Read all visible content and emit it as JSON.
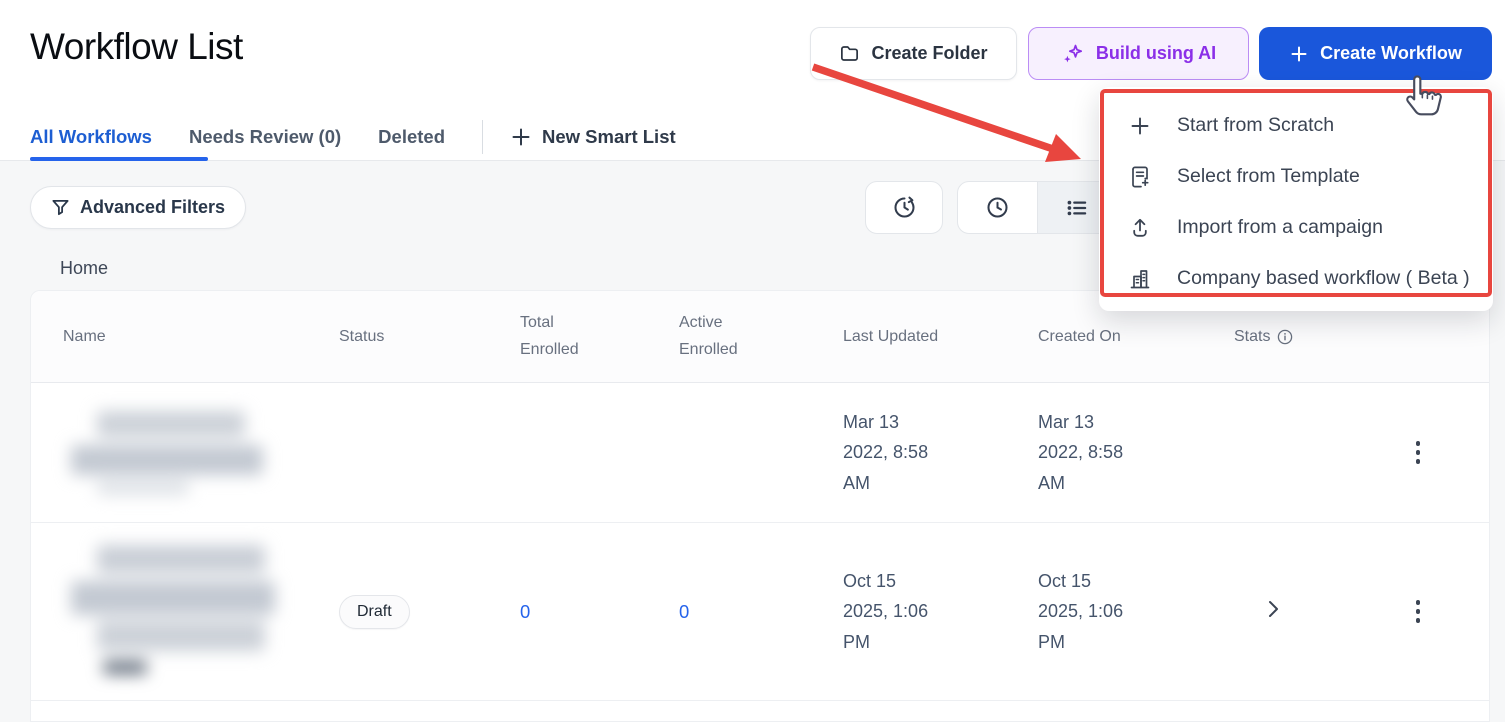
{
  "header": {
    "title": "Workflow List",
    "create_folder_label": "Create Folder",
    "build_ai_label": "Build using AI",
    "create_workflow_label": "Create Workflow"
  },
  "tabs": {
    "all_workflows": "All Workflows",
    "needs_review": "Needs Review (0)",
    "deleted": "Deleted",
    "new_smart_list": "New Smart List"
  },
  "toolbar": {
    "advanced_filters_label": "Advanced Filters",
    "icons": [
      "history-icon",
      "clock-icon",
      "list-view-icon"
    ]
  },
  "breadcrumb": {
    "home": "Home"
  },
  "create_menu": {
    "items": [
      {
        "label": "Start from Scratch",
        "icon": "plus-icon"
      },
      {
        "label": "Select from Template",
        "icon": "template-icon"
      },
      {
        "label": "Import from a campaign",
        "icon": "upload-icon"
      },
      {
        "label": "Company based workflow ( Beta )",
        "icon": "company-icon"
      }
    ]
  },
  "table": {
    "columns": {
      "name": "Name",
      "status": "Status",
      "total_enrolled": "Total Enrolled",
      "active_enrolled": "Active Enrolled",
      "last_updated": "Last Updated",
      "created_on": "Created On",
      "stats": "Stats"
    },
    "rows": [
      {
        "name_redacted": true,
        "status": "",
        "total_enrolled": "",
        "active_enrolled": "",
        "last_updated": "Mar 13 2022, 8:58 AM",
        "created_on": "Mar 13 2022, 8:58 AM"
      },
      {
        "name_redacted": true,
        "status": "Draft",
        "total_enrolled": "0",
        "active_enrolled": "0",
        "last_updated": "Oct 15 2025, 1:06 PM",
        "created_on": "Oct 15 2025, 1:06 PM"
      }
    ]
  },
  "colors": {
    "primary_blue": "#1a57db",
    "tab_active_blue": "#1d5ed2",
    "ai_purple": "#8b2fe8",
    "link_blue": "#2563eb",
    "annotation_red": "#e8463f"
  }
}
